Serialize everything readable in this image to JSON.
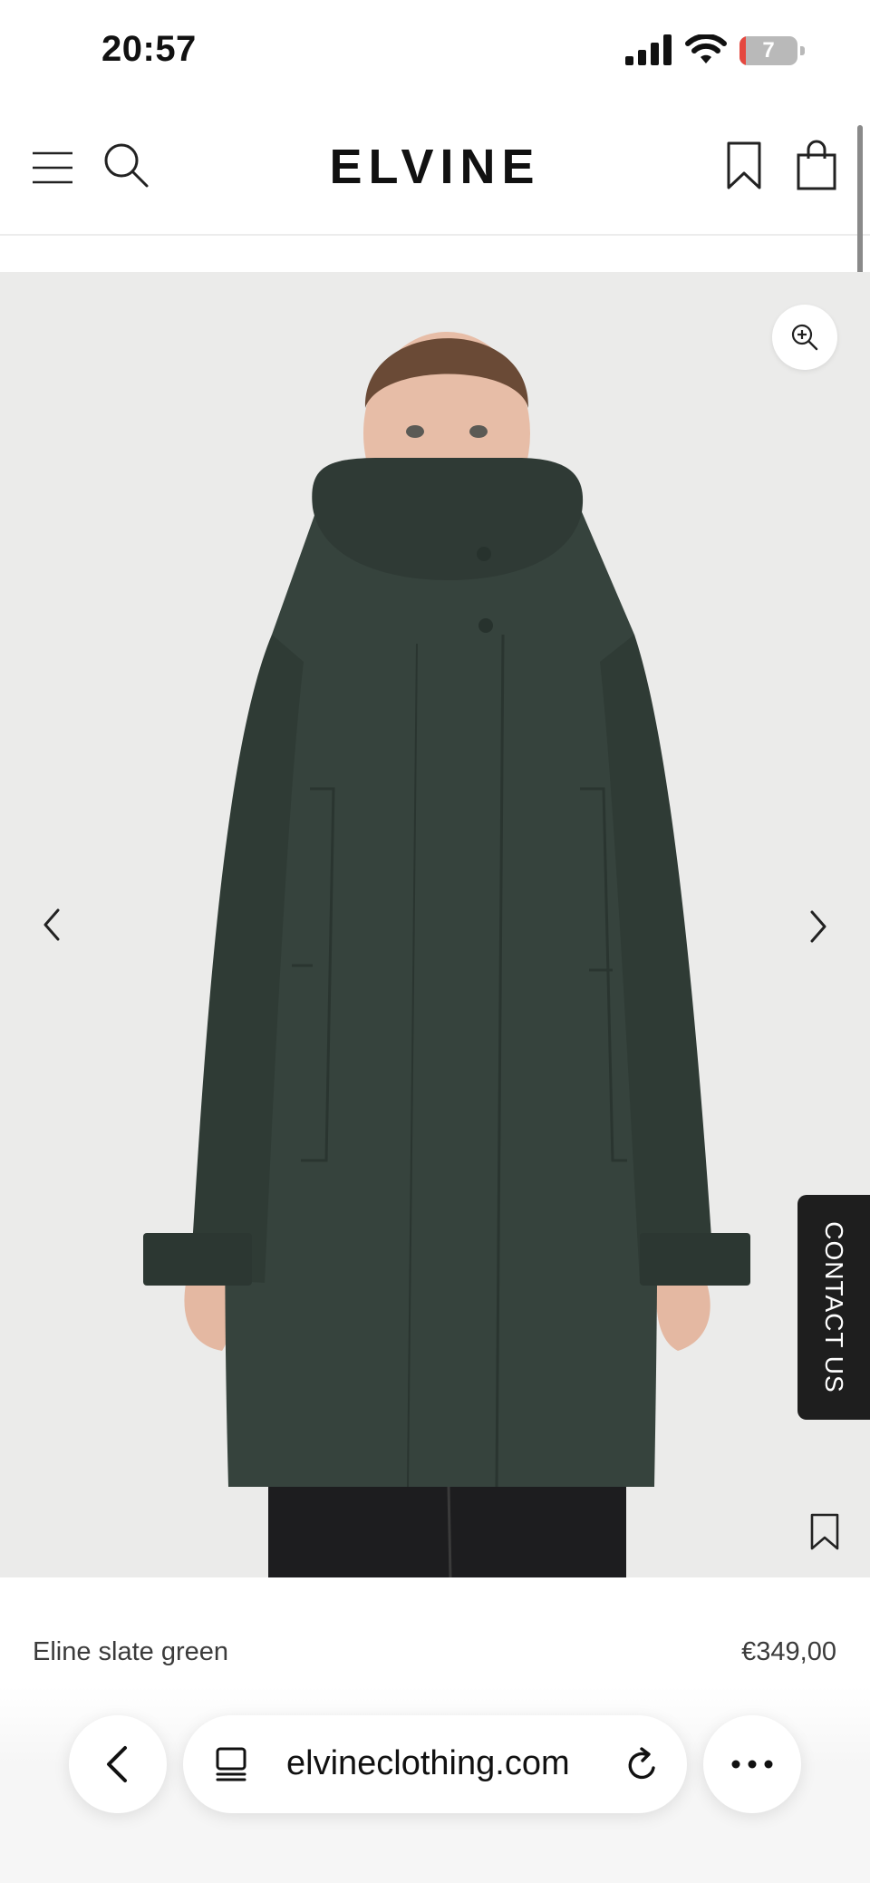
{
  "status_bar": {
    "time": "20:57",
    "battery_level": "7",
    "battery_fraction": 0.07,
    "icons": [
      "cellular-signal-icon",
      "wifi-icon",
      "battery-icon"
    ]
  },
  "header": {
    "logo": "ELVINE",
    "icons": [
      "hamburger-menu-icon",
      "search-icon",
      "bookmark-icon",
      "shopping-bag-icon"
    ]
  },
  "gallery": {
    "icons": [
      "zoom-in-icon",
      "chevron-left-icon",
      "chevron-right-icon",
      "bookmark-icon"
    ],
    "coat_color": "#36433d"
  },
  "contact_tab": {
    "label": "CONTACT US"
  },
  "product": {
    "name": "Eline slate green",
    "price": "€349,00"
  },
  "browser_bar": {
    "url": "elvineclothing.com",
    "icons": [
      "back-arrow-icon",
      "tabs-icon",
      "reload-icon",
      "more-icon"
    ]
  },
  "colors": {
    "background": "#ffffff",
    "image_background": "#ebebea",
    "coat": "#36433d",
    "contact_tab": "#1e1e1e"
  }
}
